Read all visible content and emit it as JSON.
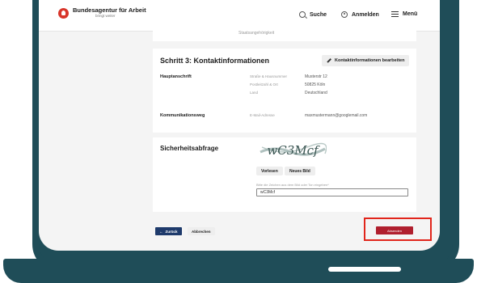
{
  "header": {
    "brand": "Bundesagentur für Arbeit",
    "brand_sub": "bringt weiter",
    "search_label": "Suche",
    "login_label": "Anmelden",
    "menu_label": "Menü"
  },
  "previous_section": {
    "text": "Staatsangehörigkeit"
  },
  "contact": {
    "step_title": "Schritt 3: Kontaktinformationen",
    "edit_label": "Kontaktinformationen bearbeiten",
    "address_label": "Hauptanschrift",
    "address_fields": [
      {
        "label": "Straße & Hausnummer",
        "value": "Musterstr 12"
      },
      {
        "label": "Postleitzahl & Ort",
        "value": "50825 Köln"
      },
      {
        "label": "Land",
        "value": "Deutschland"
      }
    ],
    "communication_label": "Kommunikationsweg",
    "email_label": "E-Mail-Adresse",
    "email_value": "maxmustermann@googlemail.com"
  },
  "captcha": {
    "title": "Sicherheitsabfrage",
    "image_text": "wC3Mcf",
    "read_aloud_label": "Vorlesen",
    "new_image_label": "Neues Bild",
    "hint": "Bitte die Zeichen aus dem Bild oder Ton eingeben*",
    "input_value": "wC3Mcf"
  },
  "actions": {
    "back_label": "Zurück",
    "cancel_label": "Abbrechen",
    "submit_label": "Absenden"
  },
  "colors": {
    "frame": "#1f4d58",
    "primary": "#1e3a6b",
    "submit": "#b01f2e",
    "highlight": "#e1251b",
    "logo": "#d8352a"
  },
  "icons": [
    "logo-icon",
    "search-icon",
    "user-icon",
    "menu-icon",
    "pencil-icon",
    "arrow-left-icon"
  ]
}
